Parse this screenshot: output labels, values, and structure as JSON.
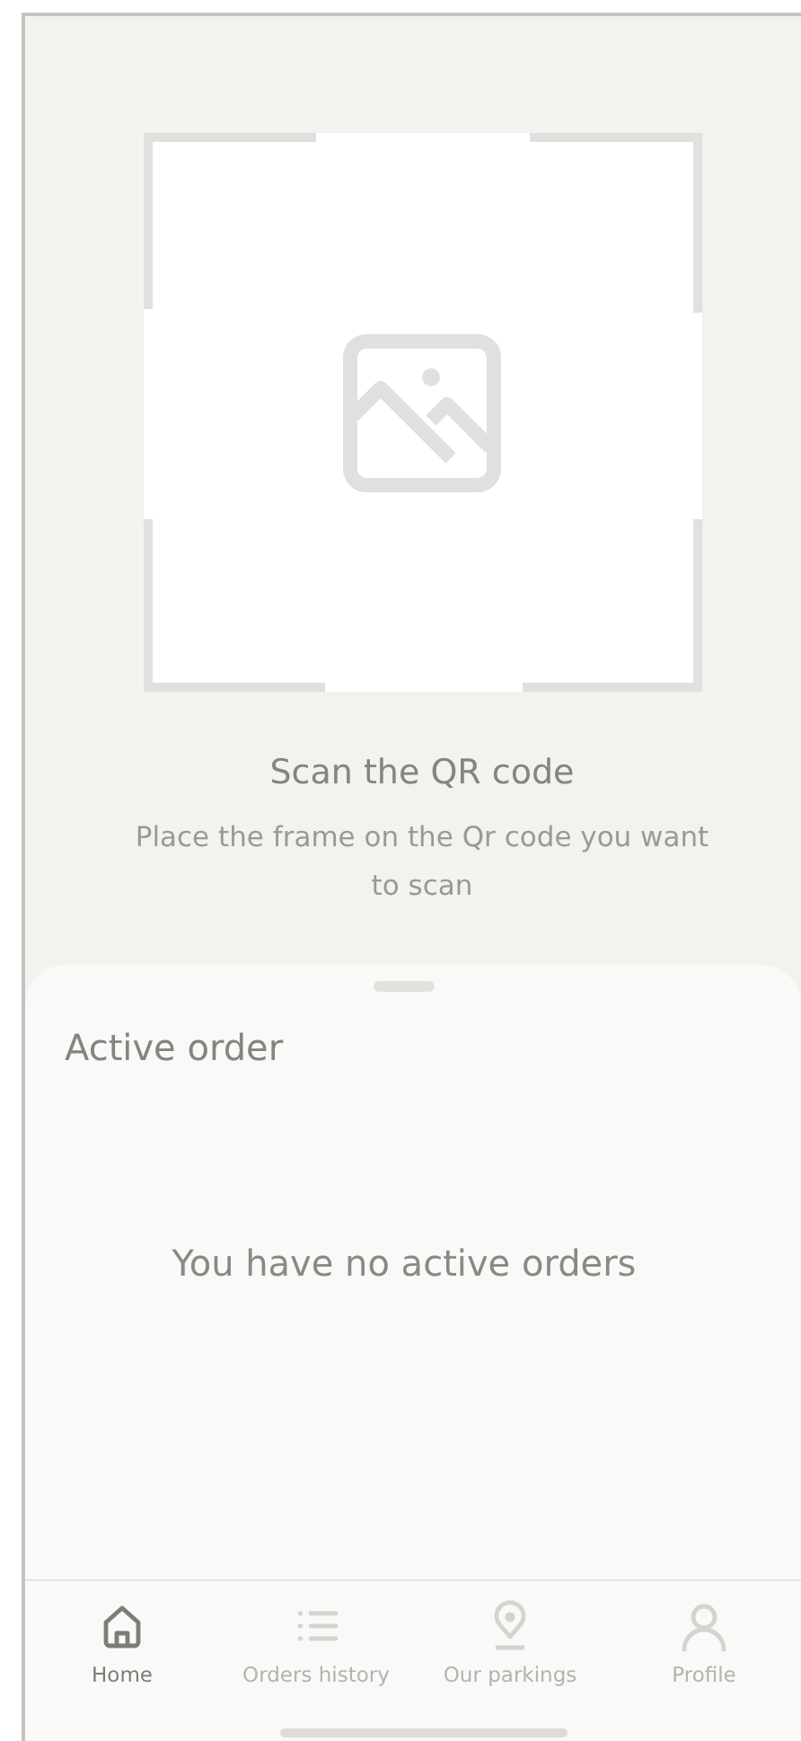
{
  "scanner": {
    "title": "Scan the QR code",
    "hint": "Place the frame on the Qr code you want to scan"
  },
  "active_order": {
    "title": "Active order",
    "empty_message": "You have no active orders"
  },
  "bottom_nav": [
    {
      "kind": "home",
      "label": "Home",
      "selected": true
    },
    {
      "kind": "list",
      "label": "Orders history",
      "selected": false
    },
    {
      "kind": "pin",
      "label": "Our parkings",
      "selected": false
    },
    {
      "kind": "person",
      "label": "Profile",
      "selected": false
    }
  ]
}
